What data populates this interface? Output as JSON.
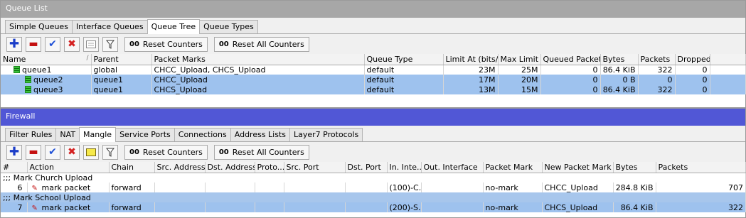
{
  "queue_window": {
    "title": "Queue List",
    "tabs": [
      "Simple Queues",
      "Interface Queues",
      "Queue Tree",
      "Queue Types"
    ],
    "toolbar": {
      "reset_counters": "Reset Counters",
      "reset_all_counters": "Reset All Counters",
      "oo": "00"
    },
    "columns": [
      "Name",
      "Parent",
      "Packet Marks",
      "Queue Type",
      "Limit At (bits/s)",
      "Max Limit ...",
      "Queued Packets",
      "Bytes",
      "Packets",
      "Dropped"
    ],
    "rows": [
      {
        "name": "queue1",
        "parent": "global",
        "marks": "CHCC_Upload, CHCS_Upload",
        "type": "default",
        "limit_at": "23M",
        "max_limit": "25M",
        "queued": "0",
        "bytes": "86.4 KiB",
        "packets": "322",
        "dropped": "0"
      },
      {
        "name": "queue2",
        "parent": "queue1",
        "marks": "CHCC_Upload",
        "type": "default",
        "limit_at": "17M",
        "max_limit": "20M",
        "queued": "0",
        "bytes": "0 B",
        "packets": "0",
        "dropped": "0"
      },
      {
        "name": "queue3",
        "parent": "queue1",
        "marks": "CHCS_Upload",
        "type": "default",
        "limit_at": "13M",
        "max_limit": "15M",
        "queued": "0",
        "bytes": "86.4 KiB",
        "packets": "322",
        "dropped": "0"
      }
    ]
  },
  "firewall_window": {
    "title": "Firewall",
    "tabs": [
      "Filter Rules",
      "NAT",
      "Mangle",
      "Service Ports",
      "Connections",
      "Address Lists",
      "Layer7 Protocols"
    ],
    "toolbar": {
      "reset_counters": "Reset Counters",
      "reset_all_counters": "Reset All Counters",
      "oo": "00"
    },
    "columns": [
      "#",
      "Action",
      "Chain",
      "Src. Address",
      "Dst. Address",
      "Proto...",
      "Src. Port",
      "Dst. Port",
      "In. Inte...",
      "Out. Interface",
      "Packet Mark",
      "New Packet Mark",
      "Bytes",
      "Packets"
    ],
    "rows": [
      {
        "comment": ";;; Mark Church Upload",
        "num": "6",
        "action": "mark packet",
        "chain": "forward",
        "in_iface": "(100)-C...",
        "packet_mark": "no-mark",
        "new_mark": "CHCC_Upload",
        "bytes": "284.8 KiB",
        "packets": "707"
      },
      {
        "comment": ";;; Mark School Upload",
        "num": "7",
        "action": "mark packet",
        "chain": "forward",
        "in_iface": "(200)-S...",
        "packet_mark": "no-mark",
        "new_mark": "CHCS_Upload",
        "bytes": "86.4 KiB",
        "packets": "322"
      }
    ]
  }
}
